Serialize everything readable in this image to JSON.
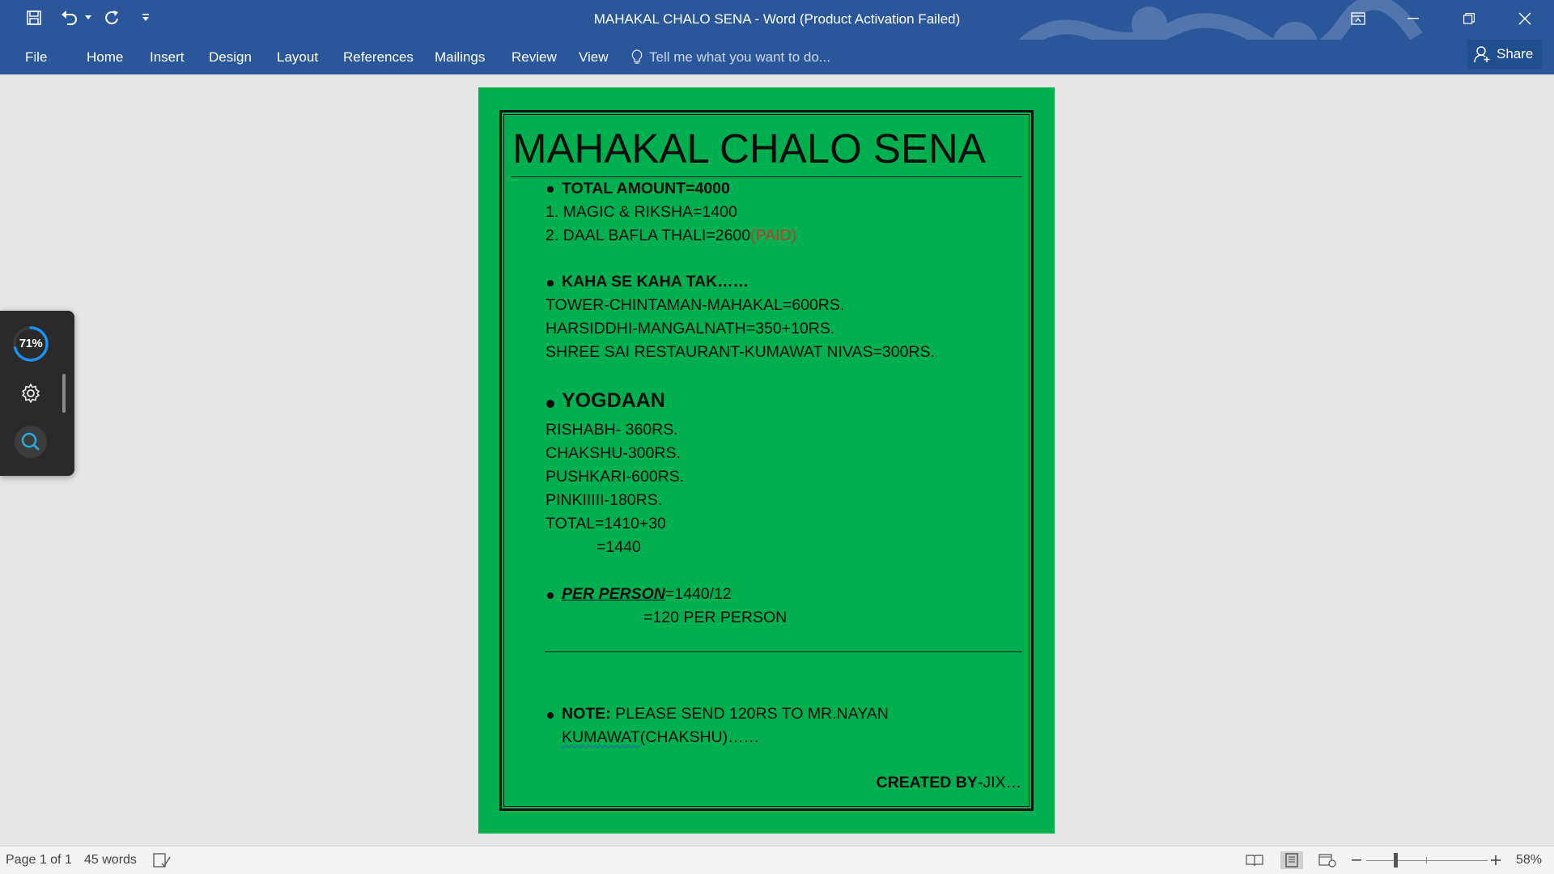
{
  "window": {
    "title": "MAHAKAL CHALO SENA - Word (Product Activation Failed)"
  },
  "ribbon": {
    "tabs": [
      "File",
      "Home",
      "Insert",
      "Design",
      "Layout",
      "References",
      "Mailings",
      "Review",
      "View"
    ],
    "tell_me_placeholder": "Tell me what you want to do...",
    "share_label": "Share"
  },
  "colors": {
    "ribbon": "#2b579a",
    "page_fill": "#00b050",
    "paid_text": "#c0392b"
  },
  "document": {
    "title": "MAHAKAL CHALO SENA",
    "total_amount": "TOTAL AMOUNT=4000",
    "items": {
      "magic": "1. MAGIC & RIKSHA=1400",
      "thali": "2. DAAL BAFLA THALI=2600",
      "thali_status": "(PAID)"
    },
    "route_heading": "KAHA SE KAHA TAK……",
    "routes": [
      "TOWER-CHINTAMAN-MAHAKAL=600RS.",
      "HARSIDDHI-MANGALNATH=350+10RS.",
      "SHREE SAI RESTAURANT-KUMAWAT NIVAS=300RS."
    ],
    "yogdaan_heading": "YOGDAAN",
    "contributions": [
      "RISHABH- 360RS.",
      "CHAKSHU-300RS.",
      "PUSHKARI-600RS.",
      "PINKIIIII-180RS.",
      "TOTAL=1410+30"
    ],
    "total_result": "=1440",
    "per_person_label": "PER PERSON",
    "per_person_calc": "=1440/12",
    "per_person_result": "=120 PER PERSON",
    "note_label": "NOTE:",
    "note_text_line1": " PLEASE SEND 120RS TO MR.NAYAN",
    "note_name": "KUMAWAT",
    "note_text_line2": "(CHAKSHU)……",
    "created_by_label": "CREATED BY",
    "created_by_name": "-JIX…"
  },
  "widget": {
    "progress_label": "71%",
    "progress": 0.71
  },
  "statusbar": {
    "page": "Page 1 of 1",
    "words": "45 words",
    "zoom": "58%"
  }
}
